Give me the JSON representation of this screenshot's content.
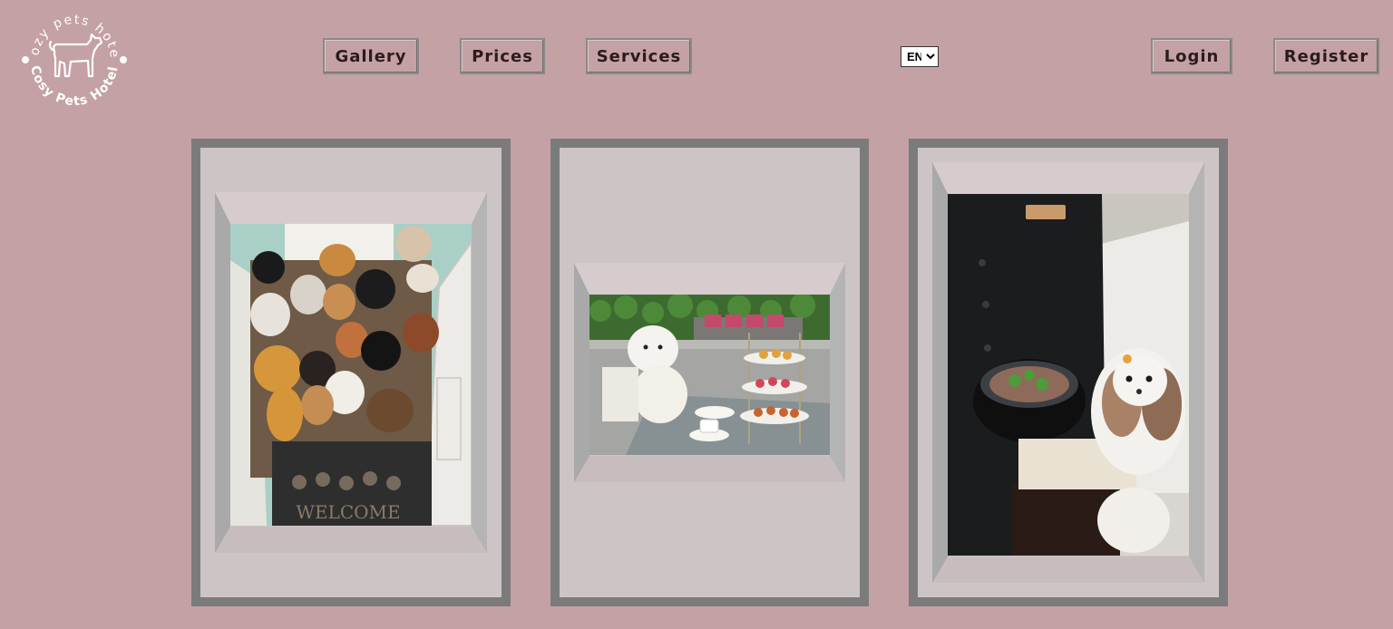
{
  "brand": {
    "logo_top_text": "cozy pets hotel",
    "logo_bottom_text": "Cosy Pets Hotel"
  },
  "nav": {
    "gallery": "Gallery",
    "prices": "Prices",
    "services": "Services",
    "login": "Login",
    "register": "Register"
  },
  "language": {
    "selected": "EN"
  },
  "gallery": {
    "photos": [
      {
        "subject": "group of dogs in doorway with welcome mat"
      },
      {
        "subject": "white poodle at afternoon tea table"
      },
      {
        "subject": "staff serving food bowl to shih tzu"
      }
    ],
    "mat_text": "WELCOME"
  }
}
